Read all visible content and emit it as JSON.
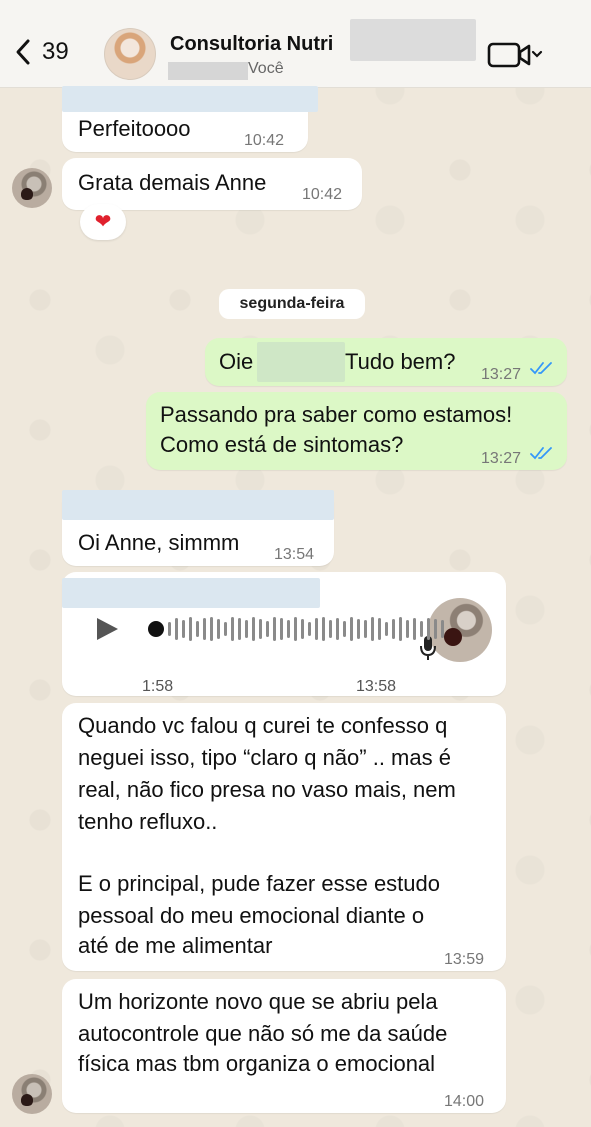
{
  "header": {
    "back_count": "39",
    "title": "Consultoria Nutri",
    "subtitle": "Você"
  },
  "messages": {
    "m1": {
      "text": "Perfeitoooo",
      "time": "10:42"
    },
    "m2": {
      "text": "Grata demais Anne",
      "time": "10:42",
      "reaction": "❤"
    },
    "date_divider": "segunda-feira",
    "m3": {
      "text_a": "Oie",
      "text_b": "Tudo bem?",
      "time": "13:27"
    },
    "m4": {
      "line1": "Passando pra saber como estamos!",
      "line2": "Como está de sintomas?",
      "time": "13:27"
    },
    "m5": {
      "text": "Oi Anne, simmm",
      "time": "13:54"
    },
    "audio": {
      "duration": "1:58",
      "time": "13:58"
    },
    "m6": {
      "line1": "Quando vc falou q curei te confesso q",
      "line2": "neguei isso, tipo “claro q não” .. mas é",
      "line3": "real, não fico presa no vaso mais, nem",
      "line4": "tenho refluxo..",
      "line5": "E o principal, pude fazer esse estudo",
      "line6": "pessoal do meu emocional diante o",
      "line7": "até de me alimentar",
      "time": "13:59"
    },
    "m7": {
      "line1": "Um horizonte novo que se abriu pela",
      "line2": "autocontrole que não só me da saúde",
      "line3": "física mas tbm organiza o emocional",
      "time": "14:00"
    }
  },
  "colors": {
    "outgoing_bubble": "#dcf8c6",
    "incoming_bubble": "#ffffff",
    "read_ticks": "#3497f9"
  }
}
